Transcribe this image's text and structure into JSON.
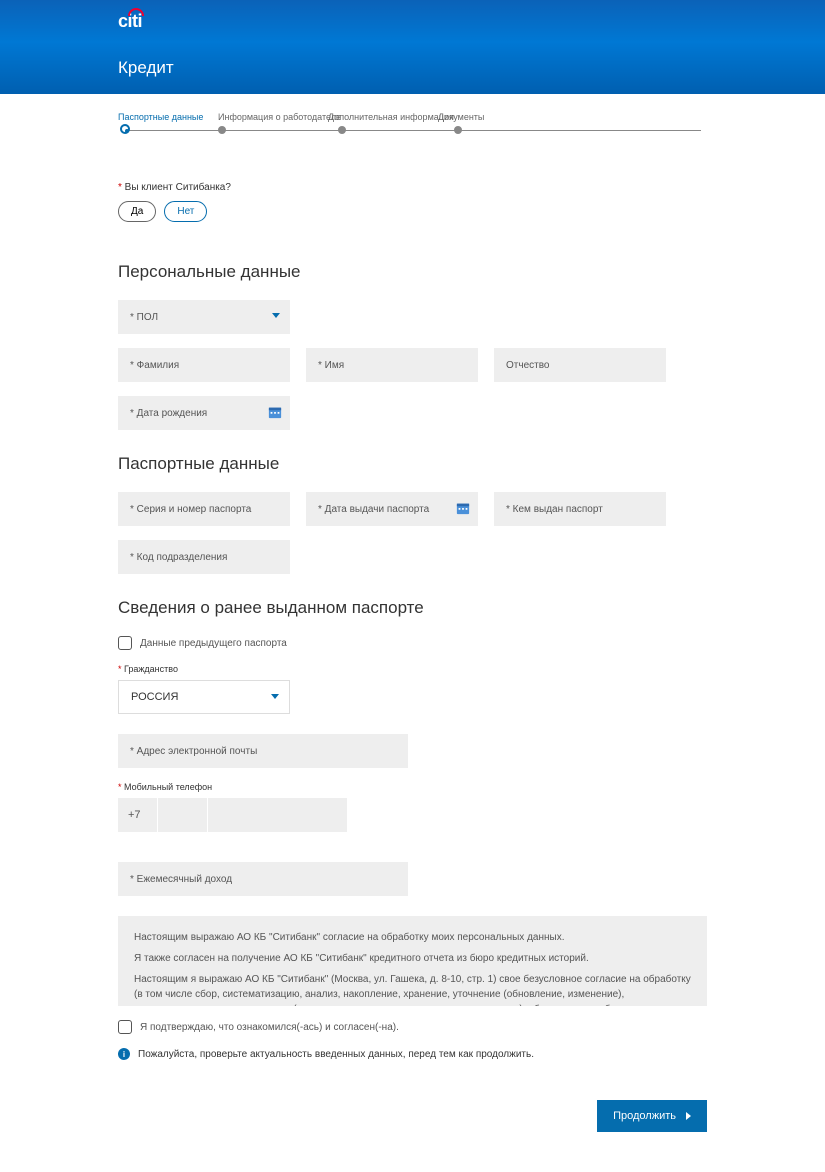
{
  "brand": "citi",
  "page_title": "Кредит",
  "stepper": [
    {
      "label": "Паспортные данные",
      "active": true
    },
    {
      "label": "Информация о работодателе",
      "active": false
    },
    {
      "label": "Дополнительная информация",
      "active": false
    },
    {
      "label": "Документы",
      "active": false
    }
  ],
  "question": {
    "label": "Вы клиент Ситибанка?",
    "yes": "Да",
    "no": "Нет"
  },
  "sections": {
    "personal": "Персональные данные",
    "passport": "Паспортные данные",
    "prev_passport": "Сведения о ранее выданном паспорте"
  },
  "fields": {
    "gender": "* ПОЛ",
    "lastname": "* Фамилия",
    "firstname": "* Имя",
    "middlename": "Отчество",
    "dob": "* Дата рождения",
    "passport_sn": "* Серия и номер паспорта",
    "passport_date": "* Дата выдачи паспорта",
    "passport_issuer": "* Кем выдан паспорт",
    "passport_code": "* Код подразделения",
    "prev_passport_cb": "Данные предыдущего паспорта",
    "citizenship_label": "Гражданство",
    "citizenship_value": "РОССИЯ",
    "email": "* Адрес электронной почты",
    "phone_label": "Мобильный телефон",
    "phone_prefix": "+7",
    "income": "* Ежемесячный доход"
  },
  "consent": {
    "p1": "Настоящим выражаю АО КБ \"Ситибанк\" согласие на обработку моих персональных данных.",
    "p2": "Я также согласен на получение АО КБ \"Ситибанк\" кредитного отчета из бюро кредитных историй.",
    "p3": "Настоящим я выражаю АО КБ \"Ситибанк\" (Москва, ул. Гашека, д. 8-10, стр. 1) свое безусловное согласие на обработку (в том числе сбор, систематизацию, анализ, накопление, хранение, уточнение (обновление, изменение), использование, распространение (в том числе передачу, включая трансграничную), обезличивание, блокирование, уничтожение и иные"
  },
  "confirm_cb": "Я подтверждаю, что ознакомился(-ась) и согласен(-на).",
  "info_msg": "Пожалуйста, проверьте актуальность введенных данных, перед тем как продолжить.",
  "continue_btn": "Продолжить"
}
